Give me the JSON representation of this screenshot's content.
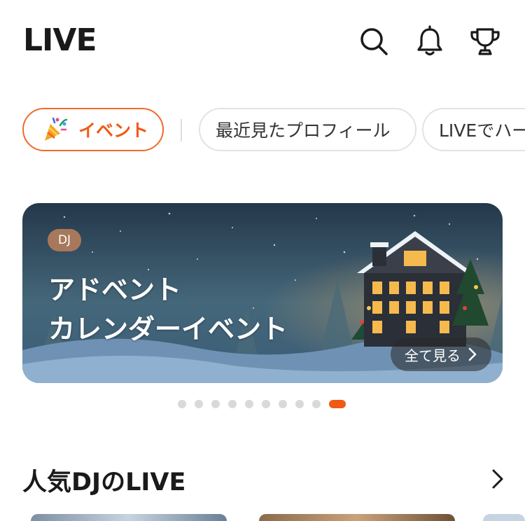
{
  "header": {
    "title": "LIVE",
    "icons": [
      "search-icon",
      "bell-icon",
      "trophy-icon"
    ]
  },
  "chips": {
    "event_label": "イベント",
    "recent_label": "最近見たプロフィール",
    "live_label": "LIVEでハート"
  },
  "banner": {
    "badge": "DJ",
    "title": "アドベント\nカレンダーイベント",
    "see_all": "全て見る",
    "page_count": 10,
    "active_page": 10
  },
  "section": {
    "title": "人気DJのLIVE"
  },
  "colors": {
    "accent": "#f05a14",
    "badge": "#a8785c"
  }
}
